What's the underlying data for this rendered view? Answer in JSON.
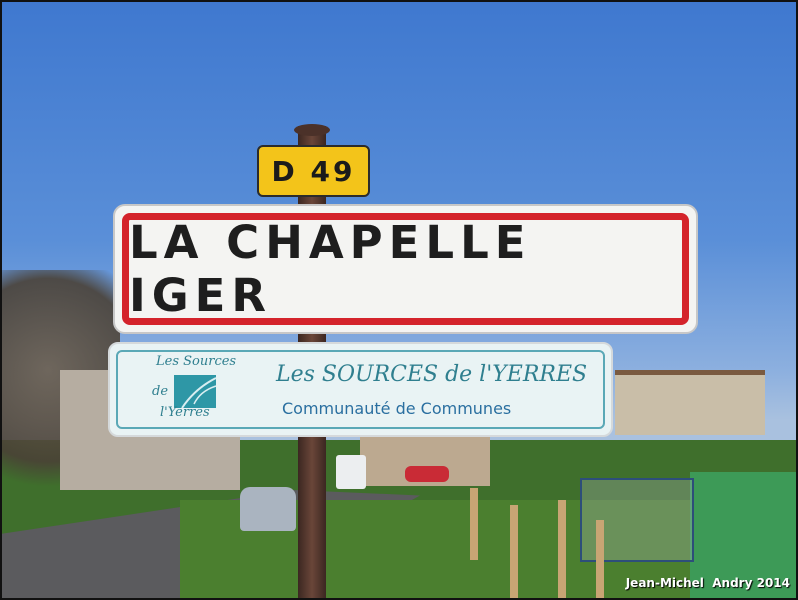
{
  "photo": {
    "route_plate": {
      "text": "D 49",
      "color": "#f3c41a"
    },
    "town_sign": {
      "text": "LA CHAPELLE IGER",
      "border_color": "#d4232b"
    },
    "community_sign": {
      "logo_line1": "Les Sources",
      "logo_line2": "de",
      "logo_line3": "l'Yerres",
      "title": "Les SOURCES de l'YERRES",
      "subtitle": "Communauté de Communes",
      "accent_color": "#2f7f8f"
    },
    "credit": "Jean-Michel  Andry 2014"
  }
}
